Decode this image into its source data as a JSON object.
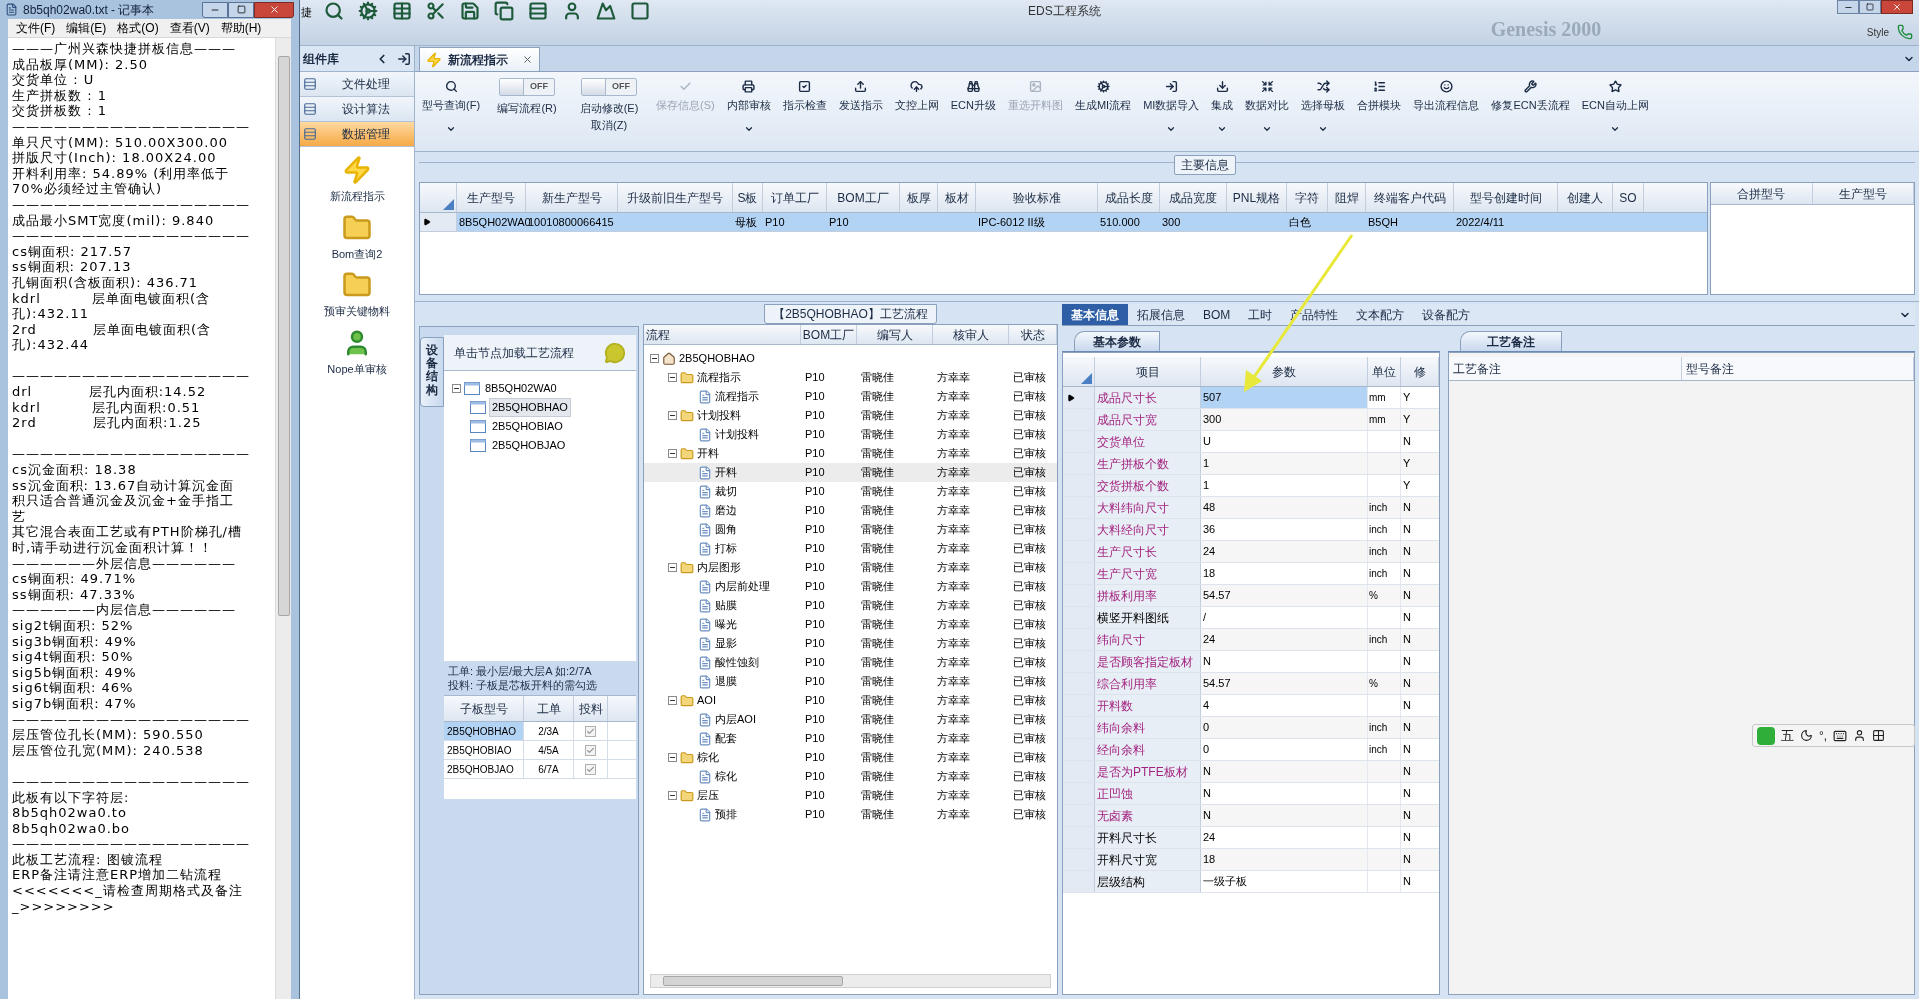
{
  "notepad": {
    "title": "8b5qh02wa0.txt - 记事本",
    "menu": [
      "文件(F)",
      "编辑(E)",
      "格式(O)",
      "查看(V)",
      "帮助(H)"
    ],
    "blocks": [
      {
        "lines": [
          "———广州兴森快捷拼板信息———",
          "成品板厚(MM): 2.50",
          "交货单位 : U",
          "生产拼板数 : 1",
          "交货拼板数 : 1",
          "—————————————————",
          "单只尺寸(MM): 510.00X300.00",
          "拼版尺寸(Inch): 18.00X24.00",
          "开料利用率: 54.89% (利用率低于",
          "70%必须经过主管确认)",
          "—————————————————",
          "成品最小SMT宽度(mil): 9.840",
          "—————————————————",
          "cs铜面积: 217.57",
          "ss铜面积: 207.13",
          "孔铜面积(含板面积): 436.71",
          "kdrl          层单面电镀面积(含",
          "孔):432.11",
          "2rd           层单面电镀面积(含",
          "孔):432.44"
        ]
      },
      {
        "lines": [
          "—————————————————",
          "drl           层孔内面积:14.52",
          "kdrl          层孔内面积:0.51",
          "2rd           层孔内面积:1.25"
        ]
      },
      {
        "lines": [
          "—————————————————",
          "cs沉金面积: 18.38",
          "ss沉金面积: 13.67自动计算沉金面",
          "积只适合普通沉金及沉金+金手指工",
          "艺",
          "其它混合表面工艺或有PTH阶梯孔/槽",
          "时,请手动进行沉金面积计算！！",
          "——————外层信息——————",
          "cs铜面积: 49.71%",
          "ss铜面积: 47.33%",
          "——————内层信息——————",
          "sig2t铜面积: 52%",
          "sig3b铜面积: 49%",
          "sig4t铜面积: 50%",
          "sig5b铜面积: 49%",
          "sig6t铜面积: 46%",
          "sig7b铜面积: 47%",
          "—————————————————",
          "层压管位孔长(MM): 590.550",
          "层压管位孔宽(MM): 240.538"
        ]
      },
      {
        "lines": [
          "—————————————————",
          "此板有以下字符层:",
          "8b5qh02wa0.to",
          "8b5qh02wa0.bo",
          "—————————————————",
          "此板工艺流程: 图镀流程",
          "ERP备注请注意ERP增加二钻流程",
          "<<<<<<<_请检查周期格式及备注",
          "_>>>>>>>>"
        ]
      }
    ]
  },
  "app": {
    "title": "EDS工程系统",
    "edge_text": "捷",
    "backdrop_text": "Genesis 2000",
    "style_label": "Style"
  },
  "nav": {
    "header": "组件库",
    "sections": [
      {
        "label": "文件处理",
        "selected": false
      },
      {
        "label": "设计算法",
        "selected": false
      },
      {
        "label": "数据管理",
        "selected": true
      }
    ],
    "tools": [
      {
        "label": "新流程指示",
        "kind": "bolt"
      },
      {
        "label": "Bom查询2",
        "kind": "folder"
      },
      {
        "label": "预审关键物料",
        "kind": "folder"
      },
      {
        "label": "Nope单审核",
        "kind": "user"
      }
    ]
  },
  "document_tab": {
    "label": "新流程指示"
  },
  "ribbon": [
    {
      "kind": "button",
      "label": "型号查询(F)",
      "dropdown": true,
      "disabled": false
    },
    {
      "kind": "toggle",
      "label": "编写流程(R)",
      "toggle_text": "OFF",
      "on": false
    },
    {
      "kind": "toggle",
      "label": "启动修改(E)",
      "sublabel": "取消(Z)",
      "toggle_text": "OFF",
      "on": false
    },
    {
      "kind": "button",
      "label": "保存信息(S)",
      "dropdown": false,
      "disabled": true
    },
    {
      "kind": "button",
      "label": "内部审核",
      "dropdown": true,
      "disabled": false
    },
    {
      "kind": "button",
      "label": "指示检查",
      "dropdown": false,
      "disabled": false
    },
    {
      "kind": "button",
      "label": "发送指示",
      "dropdown": false,
      "disabled": false
    },
    {
      "kind": "button",
      "label": "文控上网",
      "dropdown": false,
      "disabled": false
    },
    {
      "kind": "button",
      "label": "ECN升级",
      "dropdown": false,
      "disabled": false
    },
    {
      "kind": "button",
      "label": "重选开料图",
      "dropdown": false,
      "disabled": true
    },
    {
      "kind": "button",
      "label": "生成MI流程",
      "dropdown": false,
      "disabled": false
    },
    {
      "kind": "button",
      "label": "MI数据导入",
      "dropdown": true,
      "disabled": false
    },
    {
      "kind": "button",
      "label": "集成",
      "dropdown": true,
      "disabled": false
    },
    {
      "kind": "button",
      "label": "数据对比",
      "dropdown": true,
      "disabled": false
    },
    {
      "kind": "button",
      "label": "选择母板",
      "dropdown": true,
      "disabled": false
    },
    {
      "kind": "button",
      "label": "合拼模块",
      "dropdown": false,
      "disabled": false
    },
    {
      "kind": "button",
      "label": "导出流程信息",
      "dropdown": false,
      "disabled": false
    },
    {
      "kind": "button",
      "label": "修复ECN丢流程",
      "dropdown": false,
      "disabled": false
    },
    {
      "kind": "button",
      "label": "ECN自动上网",
      "dropdown": true,
      "disabled": false
    }
  ],
  "main_info": {
    "title": "主要信息",
    "row_selected": true,
    "columns": [
      {
        "header": "生产型号",
        "value": "8B5QH02WA0"
      },
      {
        "header": "新生产型号",
        "value": "10010800066415"
      },
      {
        "header": "升级前旧生产型号"
      },
      {
        "header": "S板",
        "value": "母板"
      },
      {
        "header": "订单工厂",
        "value": "P10"
      },
      {
        "header": "BOM工厂",
        "value": "P10"
      },
      {
        "header": "板厚"
      },
      {
        "header": "板材"
      },
      {
        "header": "验收标准",
        "value": "IPC-6012 II级"
      },
      {
        "header": "成品长度",
        "value": "510.000"
      },
      {
        "header": "成品宽度",
        "value": "300"
      },
      {
        "header": "PNL规格"
      },
      {
        "header": "字符",
        "value": "白色"
      },
      {
        "header": "阻焊"
      },
      {
        "header": "终端客户代码",
        "value": "B5QH"
      },
      {
        "header": "型号创建时间",
        "value": "2022/4/11"
      },
      {
        "header": "创建人"
      },
      {
        "header": "SO"
      }
    ],
    "side_columns": [
      "合拼型号",
      "生产型号"
    ]
  },
  "structure": {
    "vertical_tab": "设备结构",
    "header": "单击节点加载工艺流程",
    "tree": {
      "label": "8B5QH02WA0",
      "expanded": true,
      "selected": false,
      "children": [
        {
          "label": "2B5QHOBHAO",
          "selected": true
        },
        {
          "label": "2B5QHOBIAO",
          "selected": false
        },
        {
          "label": "2B5QHOBJAO",
          "selected": false
        }
      ]
    },
    "notes": [
      "工单: 最小层/最大层A 如:2/7A",
      "投料: 子板是芯板开料的需勾选"
    ],
    "subboards": {
      "columns": [
        "子板型号",
        "工单",
        "投料"
      ],
      "rows": [
        {
          "model": "2B5QHOBHAO",
          "order": "2/3A",
          "checked": true,
          "selected": true
        },
        {
          "model": "2B5QHOBIAO",
          "order": "4/5A",
          "checked": true,
          "selected": false
        },
        {
          "model": "2B5QHOBJAO",
          "order": "6/7A",
          "checked": true,
          "selected": false
        }
      ]
    }
  },
  "process": {
    "title": "【2B5QHOBHAO】工艺流程",
    "columns": [
      "流程",
      "BOM工厂",
      "编写人",
      "核审人",
      "状态"
    ],
    "tree": [
      {
        "kind": "root",
        "label": "2B5QHOBHAO",
        "expanded": true,
        "selected": false,
        "children": [
          {
            "kind": "folder",
            "label": "流程指示",
            "expanded": true,
            "selected": false,
            "factory": "P10",
            "writer": "雷晓佳",
            "reviewer": "方幸幸",
            "status": "已审核",
            "children": [
              {
                "kind": "step",
                "label": "流程指示",
                "selected": false,
                "factory": "P10",
                "writer": "雷晓佳",
                "reviewer": "方幸幸",
                "status": "已审核"
              }
            ]
          },
          {
            "kind": "folder",
            "label": "计划投料",
            "expanded": true,
            "selected": false,
            "factory": "P10",
            "writer": "雷晓佳",
            "reviewer": "方幸幸",
            "status": "已审核",
            "children": [
              {
                "kind": "step",
                "label": "计划投料",
                "selected": false,
                "factory": "P10",
                "writer": "雷晓佳",
                "reviewer": "方幸幸",
                "status": "已审核"
              }
            ]
          },
          {
            "kind": "folder",
            "label": "开料",
            "expanded": true,
            "selected": false,
            "factory": "P10",
            "writer": "雷晓佳",
            "reviewer": "方幸幸",
            "status": "已审核",
            "children": [
              {
                "kind": "step",
                "label": "开料",
                "selected": true,
                "factory": "P10",
                "writer": "雷晓佳",
                "reviewer": "方幸幸",
                "status": "已审核"
              },
              {
                "kind": "step",
                "label": "裁切",
                "selected": false,
                "factory": "P10",
                "writer": "雷晓佳",
                "reviewer": "方幸幸",
                "status": "已审核"
              },
              {
                "kind": "step",
                "label": "磨边",
                "selected": false,
                "factory": "P10",
                "writer": "雷晓佳",
                "reviewer": "方幸幸",
                "status": "已审核"
              },
              {
                "kind": "step",
                "label": "圆角",
                "selected": false,
                "factory": "P10",
                "writer": "雷晓佳",
                "reviewer": "方幸幸",
                "status": "已审核"
              },
              {
                "kind": "step",
                "label": "打标",
                "selected": false,
                "factory": "P10",
                "writer": "雷晓佳",
                "reviewer": "方幸幸",
                "status": "已审核"
              }
            ]
          },
          {
            "kind": "folder",
            "label": "内层图形",
            "expanded": true,
            "selected": false,
            "factory": "P10",
            "writer": "雷晓佳",
            "reviewer": "方幸幸",
            "status": "已审核",
            "children": [
              {
                "kind": "step",
                "label": "内层前处理",
                "selected": false,
                "factory": "P10",
                "writer": "雷晓佳",
                "reviewer": "方幸幸",
                "status": "已审核"
              },
              {
                "kind": "step",
                "label": "贴膜",
                "selected": false,
                "factory": "P10",
                "writer": "雷晓佳",
                "reviewer": "方幸幸",
                "status": "已审核"
              },
              {
                "kind": "step",
                "label": "曝光",
                "selected": false,
                "factory": "P10",
                "writer": "雷晓佳",
                "reviewer": "方幸幸",
                "status": "已审核"
              },
              {
                "kind": "step",
                "label": "显影",
                "selected": false,
                "factory": "P10",
                "writer": "雷晓佳",
                "reviewer": "方幸幸",
                "status": "已审核"
              },
              {
                "kind": "step",
                "label": "酸性蚀刻",
                "selected": false,
                "factory": "P10",
                "writer": "雷晓佳",
                "reviewer": "方幸幸",
                "status": "已审核"
              },
              {
                "kind": "step",
                "label": "退膜",
                "selected": false,
                "factory": "P10",
                "writer": "雷晓佳",
                "reviewer": "方幸幸",
                "status": "已审核"
              }
            ]
          },
          {
            "kind": "folder",
            "label": "AOI",
            "expanded": true,
            "selected": false,
            "factory": "P10",
            "writer": "雷晓佳",
            "reviewer": "方幸幸",
            "status": "已审核",
            "children": [
              {
                "kind": "step",
                "label": "内层AOI",
                "selected": false,
                "factory": "P10",
                "writer": "雷晓佳",
                "reviewer": "方幸幸",
                "status": "已审核"
              },
              {
                "kind": "step",
                "label": "配套",
                "selected": false,
                "factory": "P10",
                "writer": "雷晓佳",
                "reviewer": "方幸幸",
                "status": "已审核"
              }
            ]
          },
          {
            "kind": "folder",
            "label": "棕化",
            "expanded": true,
            "selected": false,
            "factory": "P10",
            "writer": "雷晓佳",
            "reviewer": "方幸幸",
            "status": "已审核",
            "children": [
              {
                "kind": "step",
                "label": "棕化",
                "selected": false,
                "factory": "P10",
                "writer": "雷晓佳",
                "reviewer": "方幸幸",
                "status": "已审核"
              }
            ]
          },
          {
            "kind": "folder",
            "label": "层压",
            "expanded": true,
            "selected": false,
            "factory": "P10",
            "writer": "雷晓佳",
            "reviewer": "方幸幸",
            "status": "已审核",
            "children": [
              {
                "kind": "step",
                "label": "预排",
                "selected": false,
                "factory": "P10",
                "writer": "雷晓佳",
                "reviewer": "方幸幸",
                "status": "已审核"
              }
            ]
          }
        ]
      }
    ]
  },
  "detail": {
    "tabs": [
      {
        "label": "基本信息",
        "selected": true
      },
      {
        "label": "拓展信息",
        "selected": false
      },
      {
        "label": "BOM",
        "selected": false
      },
      {
        "label": "工时",
        "selected": false
      },
      {
        "label": "产品特性",
        "selected": false
      },
      {
        "label": "文本配方",
        "selected": false
      },
      {
        "label": "设备配方",
        "selected": false
      }
    ],
    "params": {
      "title": "基本参数",
      "columns": [
        "项目",
        "参数",
        "单位",
        "修"
      ],
      "rows": [
        {
          "item": "成品尺寸长",
          "value": "507",
          "unit": "mm",
          "flag": "Y",
          "highlighted": true,
          "selected": true
        },
        {
          "item": "成品尺寸宽",
          "value": "300",
          "unit": "mm",
          "flag": "Y",
          "highlighted": true,
          "selected": false
        },
        {
          "item": "交货单位",
          "value": "U",
          "flag": "N",
          "highlighted": true,
          "selected": false
        },
        {
          "item": "生产拼板个数",
          "value": "1",
          "flag": "Y",
          "highlighted": true,
          "selected": false
        },
        {
          "item": "交货拼板个数",
          "value": "1",
          "flag": "Y",
          "highlighted": true,
          "selected": false
        },
        {
          "item": "大料纬向尺寸",
          "value": "48",
          "unit": "inch",
          "flag": "N",
          "highlighted": true,
          "selected": false
        },
        {
          "item": "大料经向尺寸",
          "value": "36",
          "unit": "inch",
          "flag": "N",
          "highlighted": true,
          "selected": false
        },
        {
          "item": "生产尺寸长",
          "value": "24",
          "unit": "inch",
          "flag": "N",
          "highlighted": true,
          "selected": false
        },
        {
          "item": "生产尺寸宽",
          "value": "18",
          "unit": "inch",
          "flag": "N",
          "highlighted": true,
          "selected": false
        },
        {
          "item": "拼板利用率",
          "value": "54.57",
          "unit": "%",
          "flag": "N",
          "highlighted": true,
          "selected": false
        },
        {
          "item": "横竖开料图纸",
          "value": "/",
          "flag": "N",
          "highlighted": false,
          "selected": false
        },
        {
          "item": "纬向尺寸",
          "value": "24",
          "unit": "inch",
          "flag": "N",
          "highlighted": true,
          "selected": false
        },
        {
          "item": "是否顾客指定板材",
          "value": "N",
          "flag": "N",
          "highlighted": true,
          "selected": false
        },
        {
          "item": "综合利用率",
          "value": "54.57",
          "unit": "%",
          "flag": "N",
          "highlighted": true,
          "selected": false
        },
        {
          "item": "开料数",
          "value": "4",
          "flag": "N",
          "highlighted": true,
          "selected": false
        },
        {
          "item": "纬向余料",
          "value": "0",
          "unit": "inch",
          "flag": "N",
          "highlighted": true,
          "selected": false
        },
        {
          "item": "经向余料",
          "value": "0",
          "unit": "inch",
          "flag": "N",
          "highlighted": true,
          "selected": false
        },
        {
          "item": "是否为PTFE板材",
          "value": "N",
          "flag": "N",
          "highlighted": true,
          "selected": false
        },
        {
          "item": "正凹蚀",
          "value": "N",
          "flag": "N",
          "highlighted": true,
          "selected": false
        },
        {
          "item": "无卤素",
          "value": "N",
          "flag": "N",
          "highlighted": true,
          "selected": false
        },
        {
          "item": "开料尺寸长",
          "value": "24",
          "flag": "N",
          "highlighted": false,
          "selected": false
        },
        {
          "item": "开料尺寸宽",
          "value": "18",
          "flag": "N",
          "highlighted": false,
          "selected": false
        },
        {
          "item": "层级结构",
          "value": "一级子板",
          "flag": "N",
          "highlighted": false,
          "selected": false
        }
      ]
    },
    "remarks": {
      "title": "工艺备注",
      "columns": [
        "工艺备注",
        "型号备注"
      ]
    }
  },
  "ime": {
    "mode": "五",
    "punct": "°,"
  }
}
